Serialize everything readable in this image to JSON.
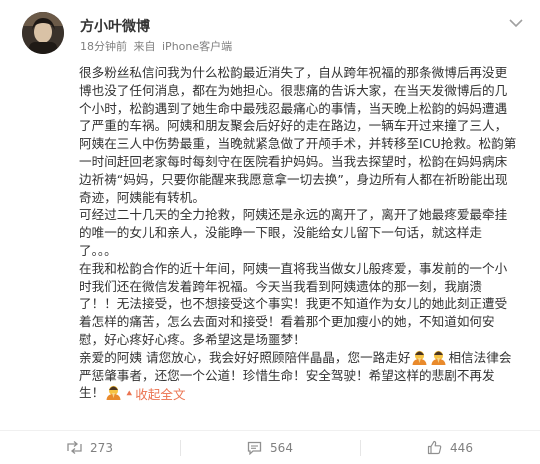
{
  "post": {
    "author": "方小叶微博",
    "time": "18分钟前",
    "source_prefix": "来自",
    "source": "iPhone客户端",
    "paragraphs": [
      "很多粉丝私信问我为什么松韵最近消失了，自从跨年祝福的那条微博后再没更博也没了任何消息，都在为她担心。很悲痛的告诉大家，在当天发微博后的几个小时，松韵遇到了她生命中最残忍最痛心的事情，当天晚上松韵的妈妈遭遇了严重的车祸。阿姨和朋友聚会后好好的走在路边，一辆车开过来撞了三人，阿姨在三人中伤势最重，当晚就紧急做了开颅手术，并转移至ICU抢救。松韵第一时间赶回老家每时每刻守在医院看护妈妈。当我去探望时，松韵在妈妈病床边祈祷“妈妈，只要你能醒来我愿意拿一切去换”，身边所有人都在祈盼能出现奇迹，阿姨能有转机。",
      "可经过二十几天的全力抢救，阿姨还是永远的离开了，离开了她最疼爱最牵挂的唯一的女儿和亲人，没能睁一下眼，没能给女儿留下一句话，就这样走了。。。",
      "在我和松韵合作的近十年间，阿姨一直将我当做女儿般疼爱，事发前的一个小时我们还在微信发着跨年祝福。今天当我看到阿姨遗体的那一刻，我崩溃了！！无法接受，也不想接受这个事实！我更不知道作为女儿的她此刻正遭受着怎样的痛苦，怎么去面对和接受！看着那个更加瘦小的她，不知道如何安慰，好心疼好心疼。多希望这是场噩梦！",
      "亲爱的阿姨 请您放心，我会好好照顾陪伴晶晶，您一路走好{e}{e}相信法律会严惩肇事者，还您一个公道！珍惜生命！安全驾驶！希望这样的悲剧不再发生！{e}"
    ],
    "collapse_label": "收起全文"
  },
  "actions": {
    "repost_count": "273",
    "comment_count": "564",
    "like_count": "446"
  },
  "colors": {
    "accent": "#eb7350",
    "text": "#333333",
    "meta": "#808080"
  },
  "icons": [
    "avatar",
    "chevron-down-icon",
    "pray-emoji",
    "repost-icon",
    "comment-icon",
    "like-icon"
  ]
}
